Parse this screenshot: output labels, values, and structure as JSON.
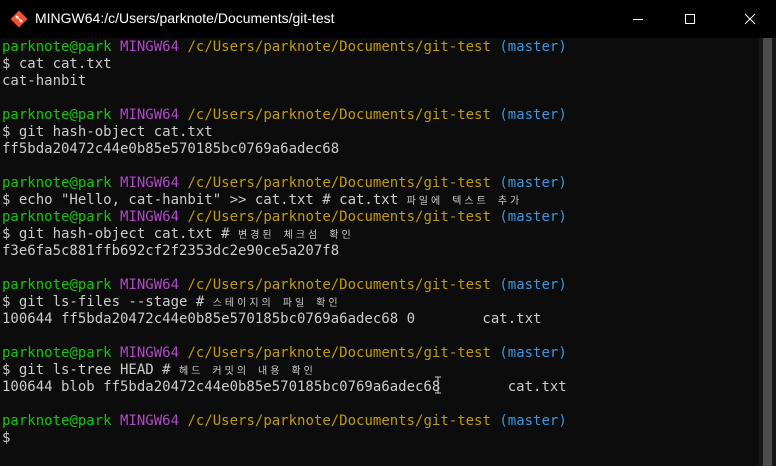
{
  "window": {
    "title": "MINGW64:/c/Users/parknote/Documents/git-test",
    "icon": "git-bash-icon",
    "controls": {
      "minimize": "minimize-icon",
      "maximize": "maximize-icon",
      "close": "close-icon"
    }
  },
  "colors": {
    "background": "#0c0c0c",
    "text": "#cccccc",
    "user": "#16c60c",
    "shell": "#b148c6",
    "path": "#c19c00",
    "branch": "#3a96dd"
  },
  "prompt": {
    "user": "parknote@park",
    "shell": "MINGW64",
    "path": "/c/Users/parknote/Documents/git-test",
    "branch": "(master)"
  },
  "lines": [
    {
      "type": "prompt"
    },
    {
      "type": "cmd",
      "cmd": "$ cat cat.txt",
      "comment": ""
    },
    {
      "type": "out",
      "text": "cat-hanbit"
    },
    {
      "type": "blank"
    },
    {
      "type": "prompt"
    },
    {
      "type": "cmd",
      "cmd": "$ git hash-object cat.txt",
      "comment": ""
    },
    {
      "type": "out",
      "text": "ff5bda20472c44e0b85e570185bc0769a6adec68"
    },
    {
      "type": "blank"
    },
    {
      "type": "prompt"
    },
    {
      "type": "cmd",
      "cmd": "$ echo \"Hello, cat-hanbit\" >> cat.txt # cat.txt ",
      "comment": "파일에 텍스트 추가"
    },
    {
      "type": "prompt"
    },
    {
      "type": "cmd",
      "cmd": "$ git hash-object cat.txt # ",
      "comment": "변경된 체크섬 확인"
    },
    {
      "type": "out",
      "text": "f3e6fa5c881ffb692cf2f2353dc2e90ce5a207f8"
    },
    {
      "type": "blank"
    },
    {
      "type": "prompt"
    },
    {
      "type": "cmd",
      "cmd": "$ git ls-files --stage # ",
      "comment": "스테이지의 파일 확인"
    },
    {
      "type": "out",
      "text": "100644 ff5bda20472c44e0b85e570185bc0769a6adec68 0\tcat.txt"
    },
    {
      "type": "blank"
    },
    {
      "type": "prompt"
    },
    {
      "type": "cmd",
      "cmd": "$ git ls-tree HEAD # ",
      "comment": "헤드 커밋의 내용 확인"
    },
    {
      "type": "out",
      "text": "100644 blob ff5bda20472c44e0b85e570185bc0769a6adec68\tcat.txt"
    },
    {
      "type": "blank"
    },
    {
      "type": "prompt"
    },
    {
      "type": "cmd",
      "cmd": "$",
      "comment": ""
    }
  ]
}
